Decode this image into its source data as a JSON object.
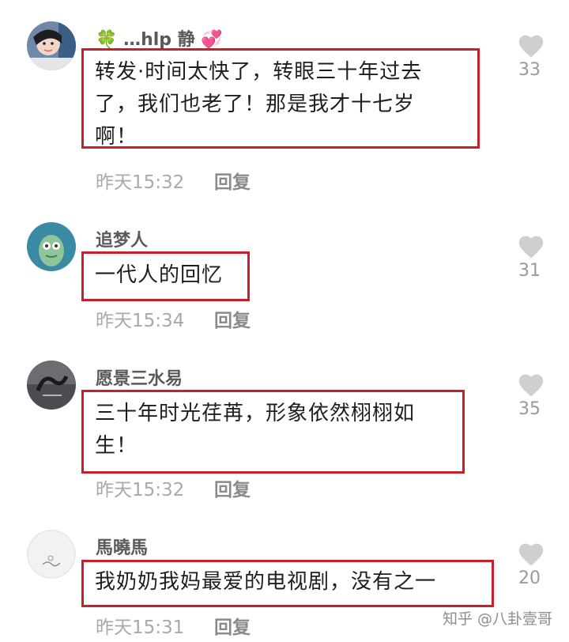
{
  "comments": [
    {
      "username": "…hlp 静",
      "lines": [
        "转发·时间太快了，转眼三十年过去",
        "了，我们也老了！那是我才十七岁",
        "啊！"
      ],
      "time": "昨天15:32",
      "reply_label": "回复",
      "likes": "33"
    },
    {
      "username": "追梦人",
      "lines": [
        "一代人的回忆"
      ],
      "time": "昨天15:34",
      "reply_label": "回复",
      "likes": "31"
    },
    {
      "username": "愿景三水易",
      "lines": [
        "三十年时光荏苒，形象依然栩栩如",
        "生！"
      ],
      "time": "昨天15:32",
      "reply_label": "回复",
      "likes": "35"
    },
    {
      "username": "馬曉馬",
      "lines": [
        "我奶奶我妈最爱的电视剧，没有之一"
      ],
      "time": "昨天15:31",
      "reply_label": "回复",
      "likes": "20"
    }
  ],
  "watermark": "知乎 @八卦壹哥",
  "colors": {
    "highlight_box": "#c8202a",
    "like_heart": "#cfcfcf"
  },
  "icons": {
    "like": "heart-icon",
    "username_prefix": "clover-icon",
    "username_suffix": "hearts-emoji-icon"
  }
}
